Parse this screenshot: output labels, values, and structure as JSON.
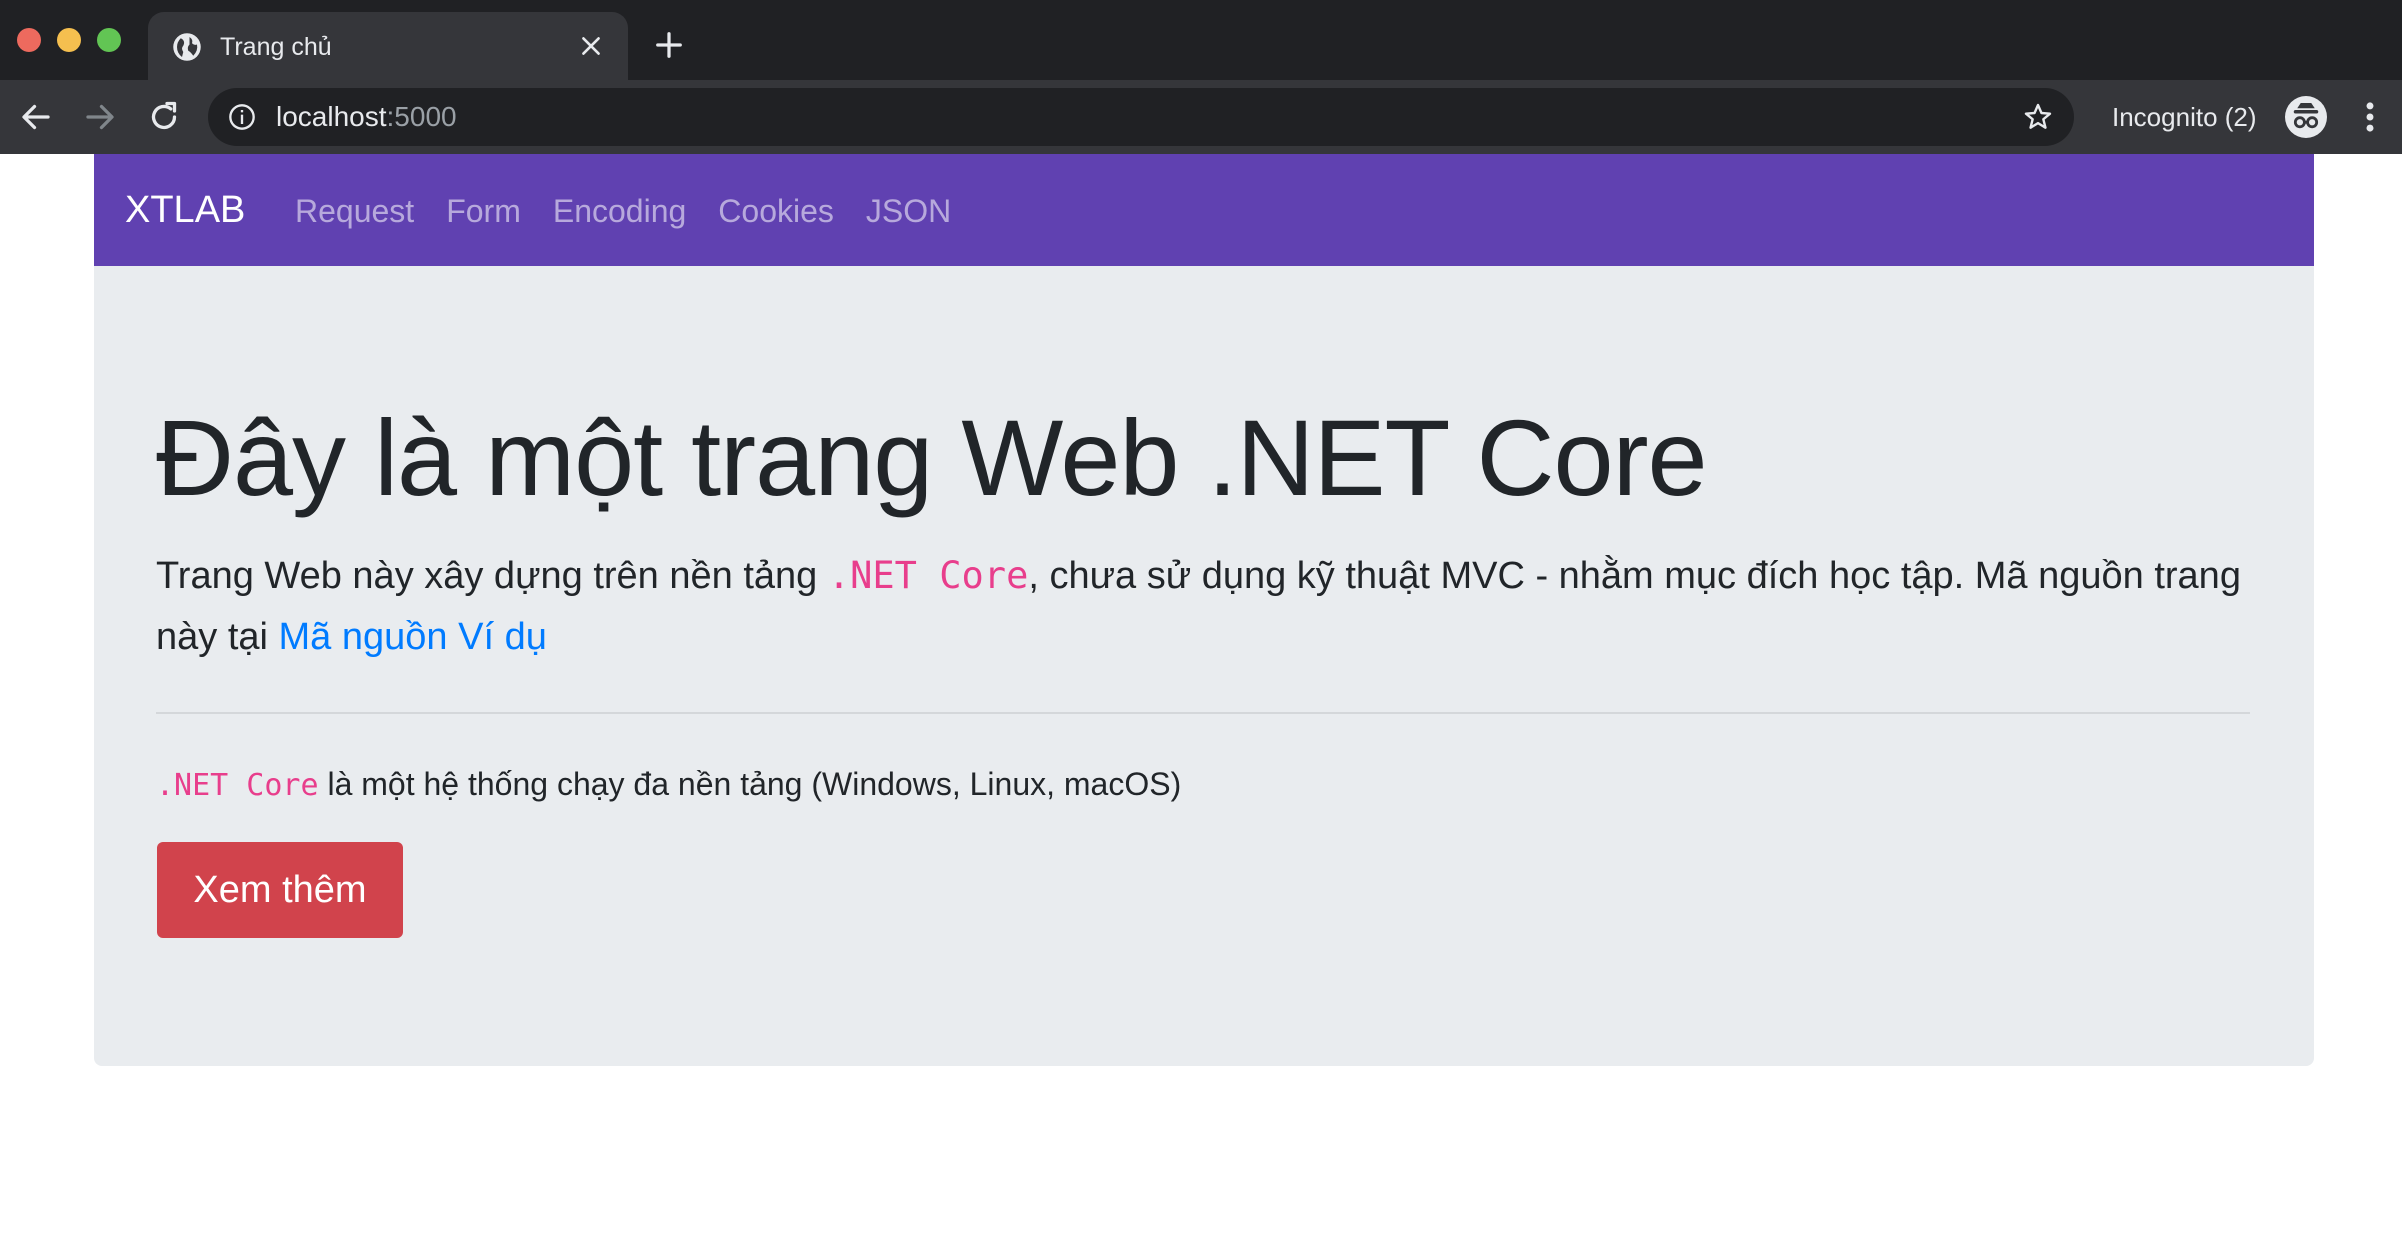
{
  "browser": {
    "tab": {
      "title": "Trang chủ",
      "favicon": "globe-icon"
    },
    "address": {
      "host": "localhost",
      "port": ":5000"
    },
    "profile": {
      "label": "Incognito (2)",
      "icon": "incognito-icon"
    }
  },
  "navbar": {
    "brand": "XTLAB",
    "links": [
      "Request",
      "Form",
      "Encoding",
      "Cookies",
      "JSON"
    ],
    "bg_color": "#6041b1"
  },
  "hero": {
    "title": "Đây là một trang Web .NET Core",
    "lead_before": "Trang Web này xây dựng trên nền tảng ",
    "lead_code": ".NET Core",
    "lead_after": ", chưa sử dụng kỹ thuật MVC - nhằm mục đích học tập. Mã nguồn trang này tại ",
    "lead_link": "Mã nguồn Ví dụ",
    "body_code": ".NET Core",
    "body_text": " là một hệ thống chạy đa nền tảng (Windows, Linux, macOS)",
    "button_label": "Xem thêm",
    "button_color": "#d1434c"
  }
}
